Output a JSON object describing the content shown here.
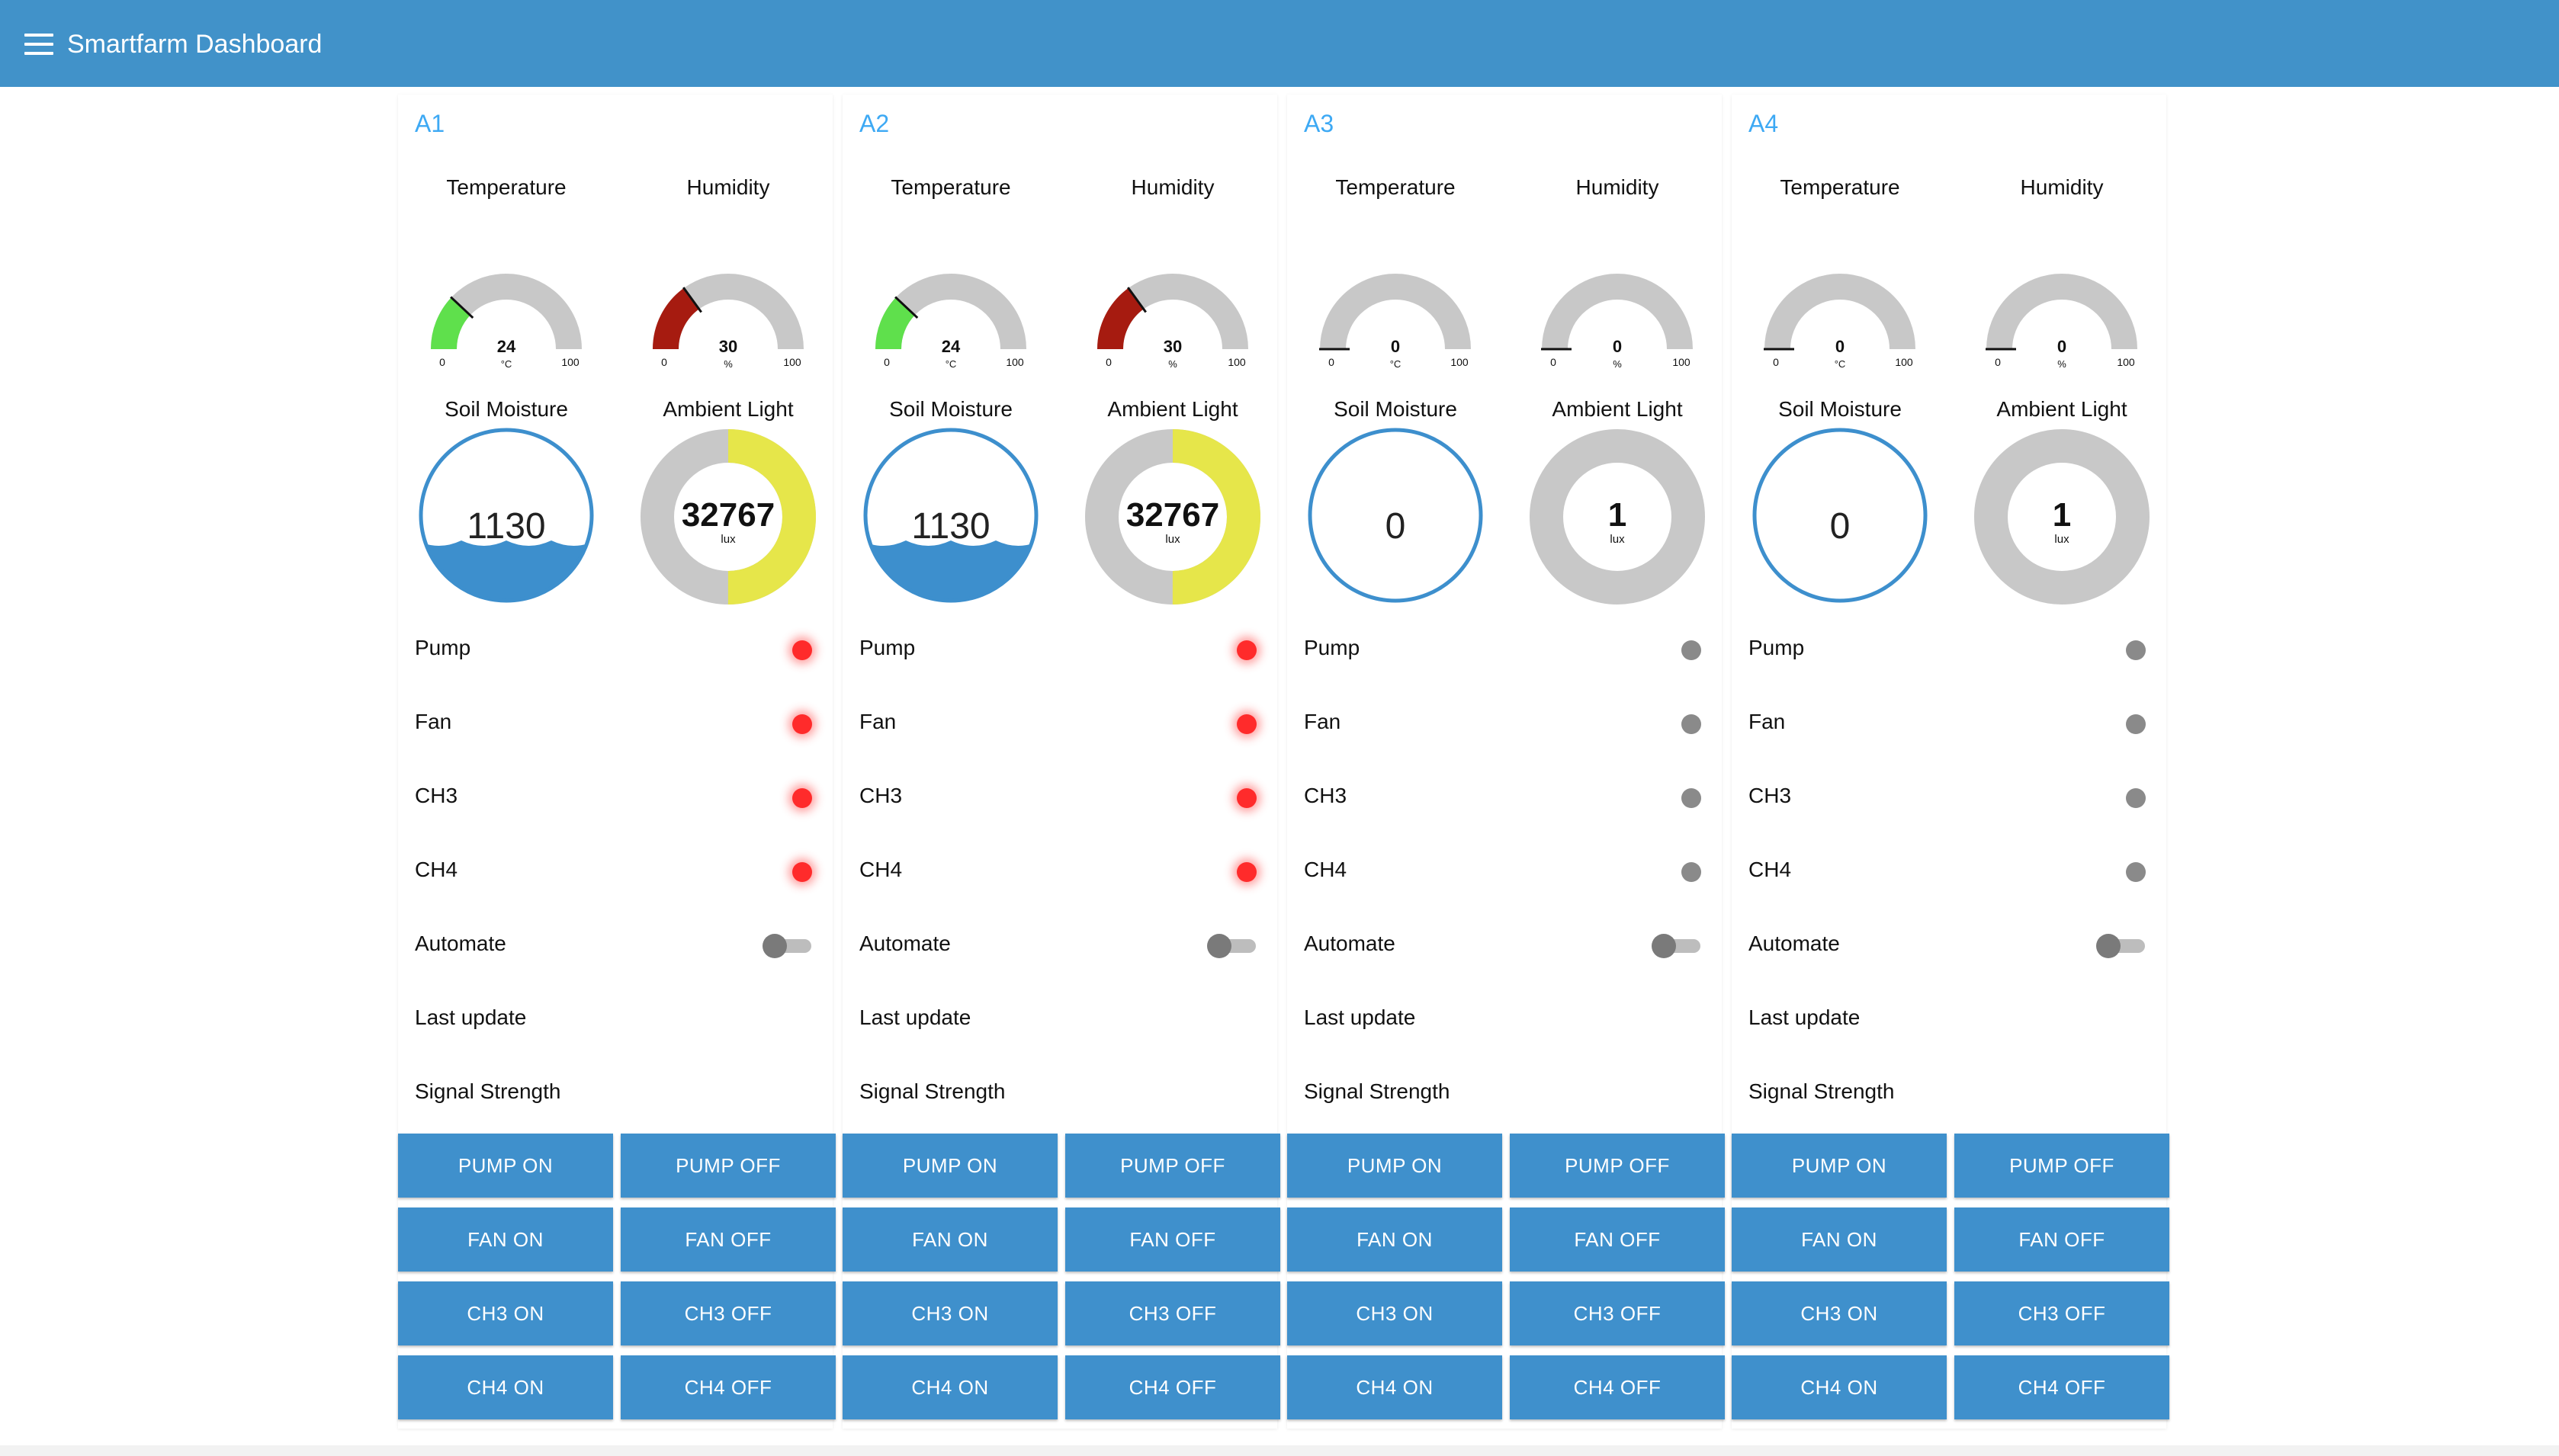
{
  "app": {
    "title": "Smartfarm Dashboard"
  },
  "colors": {
    "header": "#4192c9",
    "accent_title": "#3da9f4",
    "gauge_track": "#c8c8c8",
    "temperature_fill": "#5fe04c",
    "humidity_fill": "#a61b10",
    "water": "#3d8fcd",
    "light_fill": "#e6e64a",
    "led_on": "#ff2b2b",
    "led_off": "#8a8a8a",
    "button": "#3f90cc"
  },
  "labels": {
    "temperature": "Temperature",
    "humidity": "Humidity",
    "soil_moisture": "Soil Moisture",
    "ambient_light": "Ambient Light",
    "pump": "Pump",
    "fan": "Fan",
    "ch3": "CH3",
    "ch4": "CH4",
    "automate": "Automate",
    "last_update": "Last update",
    "signal_strength": "Signal Strength"
  },
  "buttons": {
    "pump_on": "PUMP ON",
    "pump_off": "PUMP OFF",
    "fan_on": "FAN ON",
    "fan_off": "FAN OFF",
    "ch3_on": "CH3 ON",
    "ch3_off": "CH3 OFF",
    "ch4_on": "CH4 ON",
    "ch4_off": "CH4 OFF"
  },
  "gauges": {
    "min": "0",
    "max": "100",
    "temperature_unit": "°C",
    "humidity_unit": "%",
    "light_unit": "lux"
  },
  "panels": [
    {
      "id": "A1",
      "temperature": "24",
      "humidity": "30",
      "soil_moisture": "1130",
      "soil_level": 0.35,
      "ambient_light": "32767",
      "light_fraction": 0.5,
      "leds": {
        "pump": "on",
        "fan": "on",
        "ch3": "on",
        "ch4": "on"
      },
      "automate": "off",
      "last_update": "",
      "signal_strength": ""
    },
    {
      "id": "A2",
      "temperature": "24",
      "humidity": "30",
      "soil_moisture": "1130",
      "soil_level": 0.35,
      "ambient_light": "32767",
      "light_fraction": 0.5,
      "leds": {
        "pump": "on",
        "fan": "on",
        "ch3": "on",
        "ch4": "on"
      },
      "automate": "off",
      "last_update": "",
      "signal_strength": ""
    },
    {
      "id": "A3",
      "temperature": "0",
      "humidity": "0",
      "soil_moisture": "0",
      "soil_level": 0,
      "ambient_light": "1",
      "light_fraction": 0,
      "leds": {
        "pump": "off",
        "fan": "off",
        "ch3": "off",
        "ch4": "off"
      },
      "automate": "off",
      "last_update": "",
      "signal_strength": ""
    },
    {
      "id": "A4",
      "temperature": "0",
      "humidity": "0",
      "soil_moisture": "0",
      "soil_level": 0,
      "ambient_light": "1",
      "light_fraction": 0,
      "leds": {
        "pump": "off",
        "fan": "off",
        "ch3": "off",
        "ch4": "off"
      },
      "automate": "off",
      "last_update": "",
      "signal_strength": ""
    }
  ]
}
